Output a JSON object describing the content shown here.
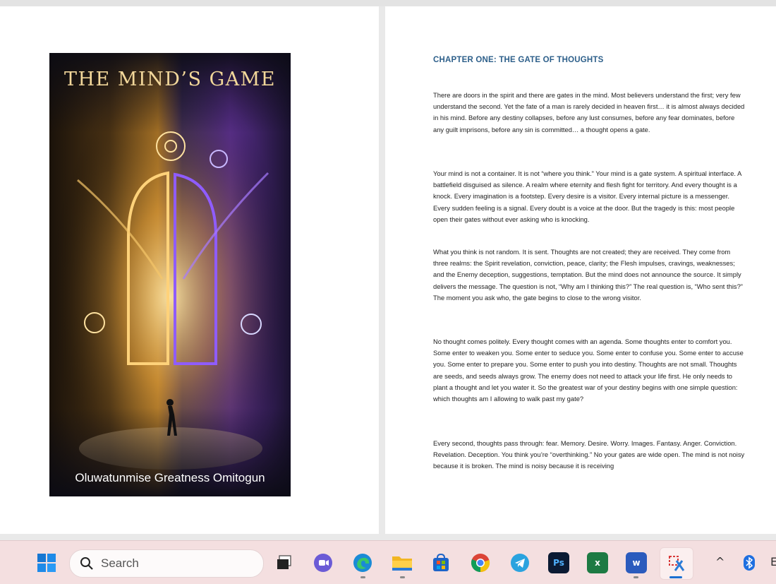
{
  "document": {
    "cover": {
      "title": "THE MIND’S GAME",
      "author": "Oluwatunmise Greatness Omitogun"
    },
    "chapter_heading": "CHAPTER ONE: THE GATE OF THOUGHTS",
    "paragraphs": [
      "There are doors in the spirit and there are gates in the mind. Most believers understand the first; very few understand the second. Yet the fate of a man is rarely decided in heaven first… it is almost always decided in his mind. Before any destiny collapses, before any lust consumes, before any fear dominates, before any guilt imprisons, before any sin is committed… a thought opens a gate.",
      "Your mind is not a container. It is not “where you think.” Your mind is a gate system. A spiritual interface. A battlefield disguised as silence. A realm where eternity and flesh fight for territory. And every thought is a knock. Every imagination is a footstep. Every desire is a visitor. Every internal picture is a messenger. Every sudden feeling is a signal. Every doubt is a voice at the door. But the tragedy is this: most people open their gates without ever asking who is knocking.",
      "What you think is not random. It is sent. Thoughts are not created; they are received. They come from three realms: the Spirit  revelation, conviction, peace, clarity; the Flesh impulses, cravings, weaknesses; and the Enemy  deception, suggestions, temptation. But the mind does not announce the source. It simply delivers the message. The question is not, “Why am I thinking this?” The real question is, “Who sent this?” The moment you ask who, the gate begins to close to the wrong visitor.",
      "No thought comes politely. Every thought comes with an agenda. Some thoughts enter to comfort you. Some enter to weaken you. Some enter to seduce you. Some enter to confuse you. Some enter to accuse you. Some enter to prepare you. Some enter to push you into destiny. Thoughts are not small. Thoughts are seeds, and seeds always grow. The enemy does not need to attack your life first. He only needs to plant a thought and let you water it. So the greatest war of your destiny begins with one simple question: which thoughts am I allowing to walk past my gate?",
      "Every second, thoughts pass through: fear. Memory. Desire. Worry. Images. Fantasy. Anger. Conviction. Revelation. Deception. You think you’re “overthinking.” No  your gates are wide open. The mind is not noisy because it is broken. The mind is noisy because it is receiving"
    ]
  },
  "taskbar": {
    "search_placeholder": "Search",
    "apps": [
      {
        "name": "windows-start",
        "icon": "windows-logo-icon"
      },
      {
        "name": "task-view",
        "icon": "task-view-icon"
      },
      {
        "name": "teams-meet",
        "icon": "video-chat-icon"
      },
      {
        "name": "edge",
        "icon": "edge-browser-icon"
      },
      {
        "name": "file-explorer",
        "icon": "folder-icon"
      },
      {
        "name": "microsoft-store",
        "icon": "store-icon"
      },
      {
        "name": "chrome",
        "icon": "chrome-icon"
      },
      {
        "name": "telegram",
        "icon": "telegram-icon"
      },
      {
        "name": "photoshop",
        "icon": "photoshop-icon",
        "label": "Ps"
      },
      {
        "name": "excel",
        "icon": "excel-icon",
        "label": "x"
      },
      {
        "name": "word",
        "icon": "word-icon",
        "label": "w"
      },
      {
        "name": "snipping-tool",
        "icon": "snipping-tool-icon"
      }
    ],
    "tray": {
      "chevron": "^",
      "bluetooth": "bluetooth-icon",
      "edge_char": "E"
    }
  },
  "colors": {
    "chapter_heading": "#2d5f8a",
    "taskbar_bg": "#f4dfe0",
    "active_indicator": "#1a6fd1"
  }
}
